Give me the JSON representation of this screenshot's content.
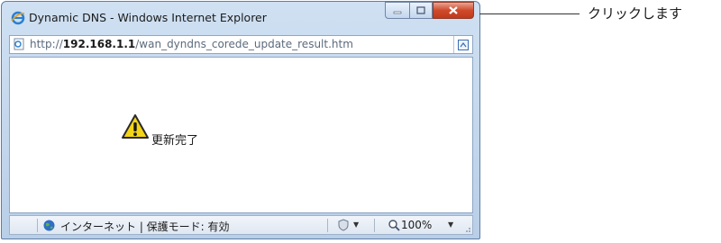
{
  "window": {
    "title": "Dynamic DNS - Windows Internet Explorer"
  },
  "address": {
    "url_prefix": "http://",
    "url_host": "192.168.1.1",
    "url_path": "/wan_dyndns_corede_update_result.htm"
  },
  "content": {
    "message": "更新完了"
  },
  "status": {
    "zone": "インターネット | 保護モード: 有効",
    "zoom": "100%"
  },
  "callout": {
    "text": "クリックします"
  },
  "icons": {
    "browser": "ie-icon",
    "warning": "warning-icon",
    "globe": "globe-icon",
    "shield": "shield-icon",
    "zoom": "zoom-icon"
  }
}
